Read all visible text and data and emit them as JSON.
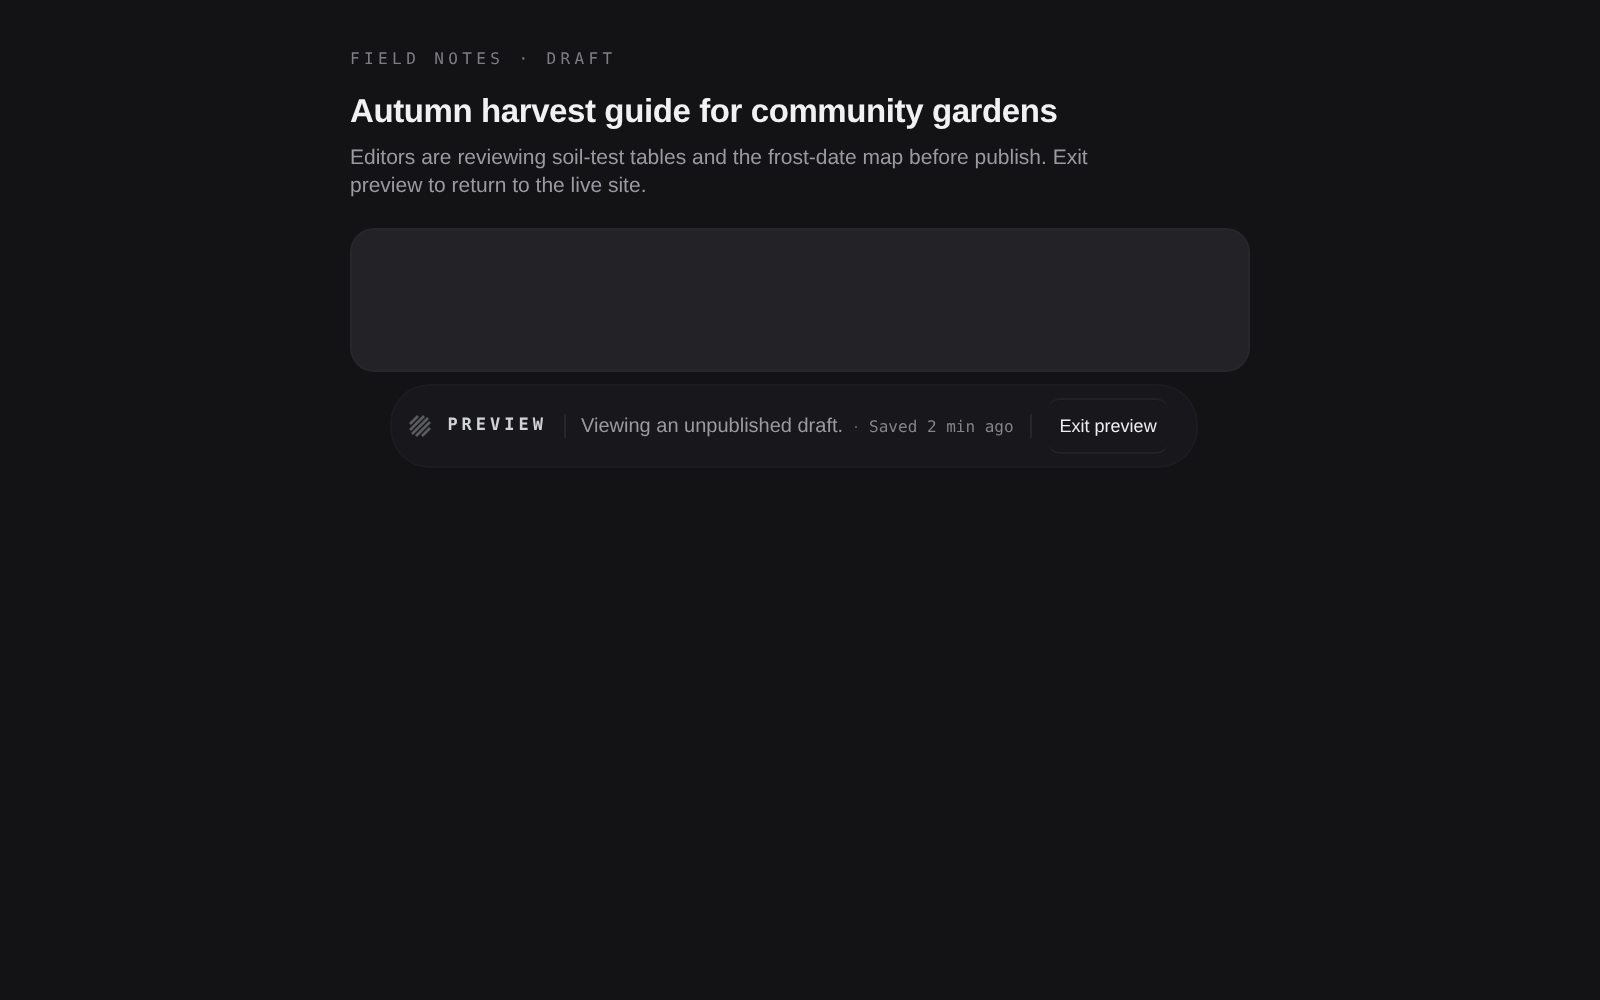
{
  "eyebrow": "FIELD NOTES · DRAFT",
  "title": "Autumn harvest guide for community gardens",
  "description": "Editors are reviewing soil-test tables and the frost-date map before publish. Exit preview to return to the live site.",
  "preview_bar": {
    "label": "PREVIEW",
    "message": "Viewing an unpublished draft.",
    "separator": "·",
    "saved": "Saved 2 min ago",
    "button": "Exit preview"
  }
}
